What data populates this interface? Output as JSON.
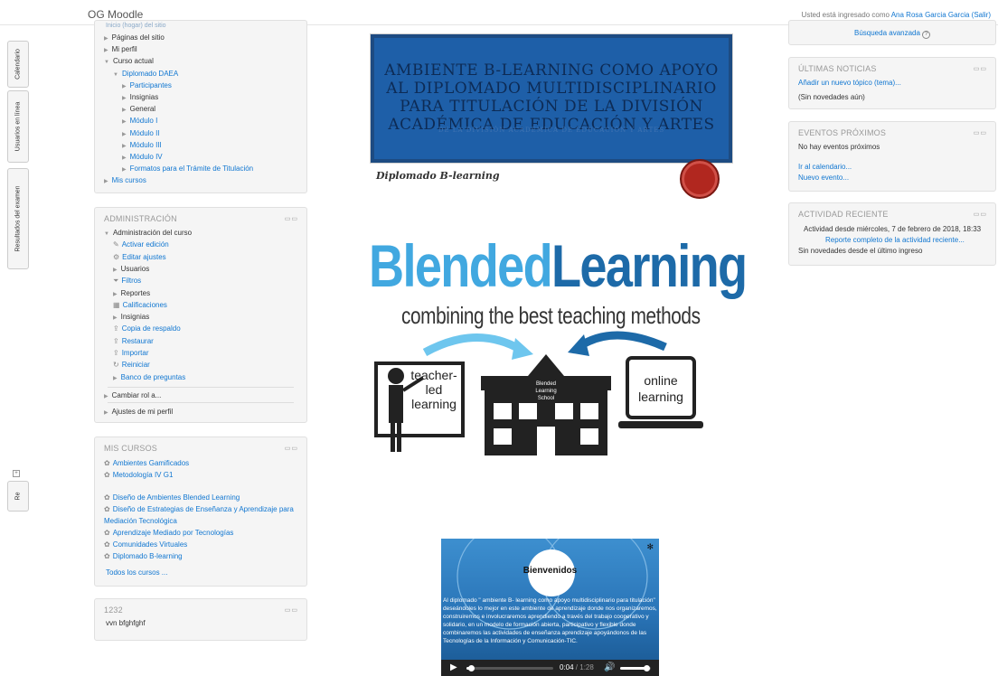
{
  "header": {
    "brand": "OG Moodle",
    "login_prefix": "Usted está ingresado como",
    "user_name": "Ana Rosa Garcia Garcia",
    "logout": "(Salir)"
  },
  "dock": [
    "Calendario",
    "Usuarios en línea",
    "Resultados del examen",
    "Re"
  ],
  "navigation": {
    "cut_item": "Inicio (hogar) del sitio",
    "items": [
      {
        "label": "Páginas del sitio",
        "level": 0,
        "link": false
      },
      {
        "label": "Mi perfil",
        "level": 0,
        "link": false
      },
      {
        "label": "Curso actual",
        "level": 0,
        "link": false
      },
      {
        "label": "Diplomado DAEA",
        "level": 1,
        "link": true
      },
      {
        "label": "Participantes",
        "level": 2,
        "link": true
      },
      {
        "label": "Insignias",
        "level": 2,
        "link": false
      },
      {
        "label": "General",
        "level": 2,
        "link": false
      },
      {
        "label": "Módulo I",
        "level": 2,
        "link": true
      },
      {
        "label": "Módulo II",
        "level": 2,
        "link": true
      },
      {
        "label": "Módulo III",
        "level": 2,
        "link": true
      },
      {
        "label": "Módulo IV",
        "level": 2,
        "link": true
      },
      {
        "label": "Formatos para el Trámite de Titulación",
        "level": 2,
        "link": true
      },
      {
        "label": "Mis cursos",
        "level": 0,
        "link": true
      }
    ]
  },
  "admin": {
    "title": "ADMINISTRACIÓN",
    "items": [
      {
        "label": "Administración del curso",
        "icon": "triangle-down",
        "level": 0,
        "link": false
      },
      {
        "label": "Activar edición",
        "icon": "pencil-icon",
        "level": 1,
        "link": true
      },
      {
        "label": "Editar ajustes",
        "icon": "gear-icon",
        "level": 1,
        "link": true
      },
      {
        "label": "Usuarios",
        "icon": "triangle-right",
        "level": 1,
        "link": false
      },
      {
        "label": "Filtros",
        "icon": "filter-icon",
        "level": 1,
        "link": true
      },
      {
        "label": "Reportes",
        "icon": "triangle-right",
        "level": 1,
        "link": false
      },
      {
        "label": "Calificaciones",
        "icon": "table-icon",
        "level": 1,
        "link": true
      },
      {
        "label": "Insignias",
        "icon": "triangle-right",
        "level": 1,
        "link": false
      },
      {
        "label": "Copia de respaldo",
        "icon": "upload-icon",
        "level": 1,
        "link": true
      },
      {
        "label": "Restaurar",
        "icon": "upload-icon",
        "level": 1,
        "link": true
      },
      {
        "label": "Importar",
        "icon": "upload-icon",
        "level": 1,
        "link": true
      },
      {
        "label": "Reiniciar",
        "icon": "reset-icon",
        "level": 1,
        "link": true
      },
      {
        "label": "Banco de preguntas",
        "icon": "triangle-right",
        "level": 1,
        "link": true
      }
    ],
    "switch_role": "Cambiar rol a...",
    "profile_settings": "Ajustes de mi perfil"
  },
  "mycourses": {
    "title": "MIS CURSOS",
    "items": [
      "Ambientes Gamificados",
      "Metodología IV G1",
      "Diseño de Ambientes Blended Learning",
      "Diseño de Estrategias de Enseñanza y Aprendizaje para Mediación Tecnológica",
      "Aprendizaje Mediado por Tecnologías",
      "Comunidades Virtuales",
      "Diplomado B-learning"
    ],
    "all_courses": "Todos los cursos ..."
  },
  "custom_block": {
    "title": "1232",
    "text": "vvn bfghfghf"
  },
  "right": {
    "advanced_search": "Búsqueda avanzada",
    "news": {
      "title": "ÚLTIMAS NOTICIAS",
      "add": "Añadir un nuevo tópico (tema)...",
      "none": "(Sin novedades aún)"
    },
    "events": {
      "title": "EVENTOS PRÓXIMOS",
      "none": "No hay eventos próximos",
      "calendar": "Ir al calendario...",
      "new_event": "Nuevo evento..."
    },
    "activity": {
      "title": "ACTIVIDAD RECIENTE",
      "since": "Actividad desde miércoles, 7 de febrero de 2018, 18:33",
      "report": "Reporte completo de la actividad reciente...",
      "none": "Sin novedades desde el último ingreso"
    }
  },
  "content": {
    "banner_title": "AMBIENTE B-LEARNING COMO APOYO AL DIPLOMADO MULTIDISCIPLINARIO PARA TITULACIÓN DE LA DIVISIÓN ACADÉMICA DE EDUCACIÓN Y ARTES",
    "banner_shadow": "DE LA DIVISIÓN ACADÉMICA DE EDUCACIÓN Y ARTES",
    "subtitle": "Diplomado B-learning",
    "bl_word1": "Blended",
    "bl_word2": "Learning",
    "bl_sub": "combining the best teaching methods",
    "teacher": [
      "teacher-",
      "led",
      "learning"
    ],
    "school": [
      "Blended",
      "Learning",
      "School"
    ],
    "online": [
      "online",
      "learning"
    ]
  },
  "video": {
    "title": "Bienvenidos",
    "text": "Al diplomado \" ambiente B- learning como apoyo multidisciplinario para titulación\" deseándoles lo mejor en este ambiente de aprendizaje donde nos organizaremos, construiremos e involucraremos aprendiendo a través del trabajo cooperativo y solidario, en un modelo de formación abierta, participativo y flexible donde combinaremos las actividades de enseñanza aprendizaje apoyándonos de las Tecnologías de la Información y Comunicación-TIC.",
    "current": "0:04",
    "duration": "1:28",
    "progress": 0.05,
    "volume": 0.85
  },
  "colors": {
    "link": "#1177d1",
    "banner_blue": "#1e5fa8",
    "bl_light": "#41a8e0",
    "bl_dark": "#1d6aa8"
  }
}
